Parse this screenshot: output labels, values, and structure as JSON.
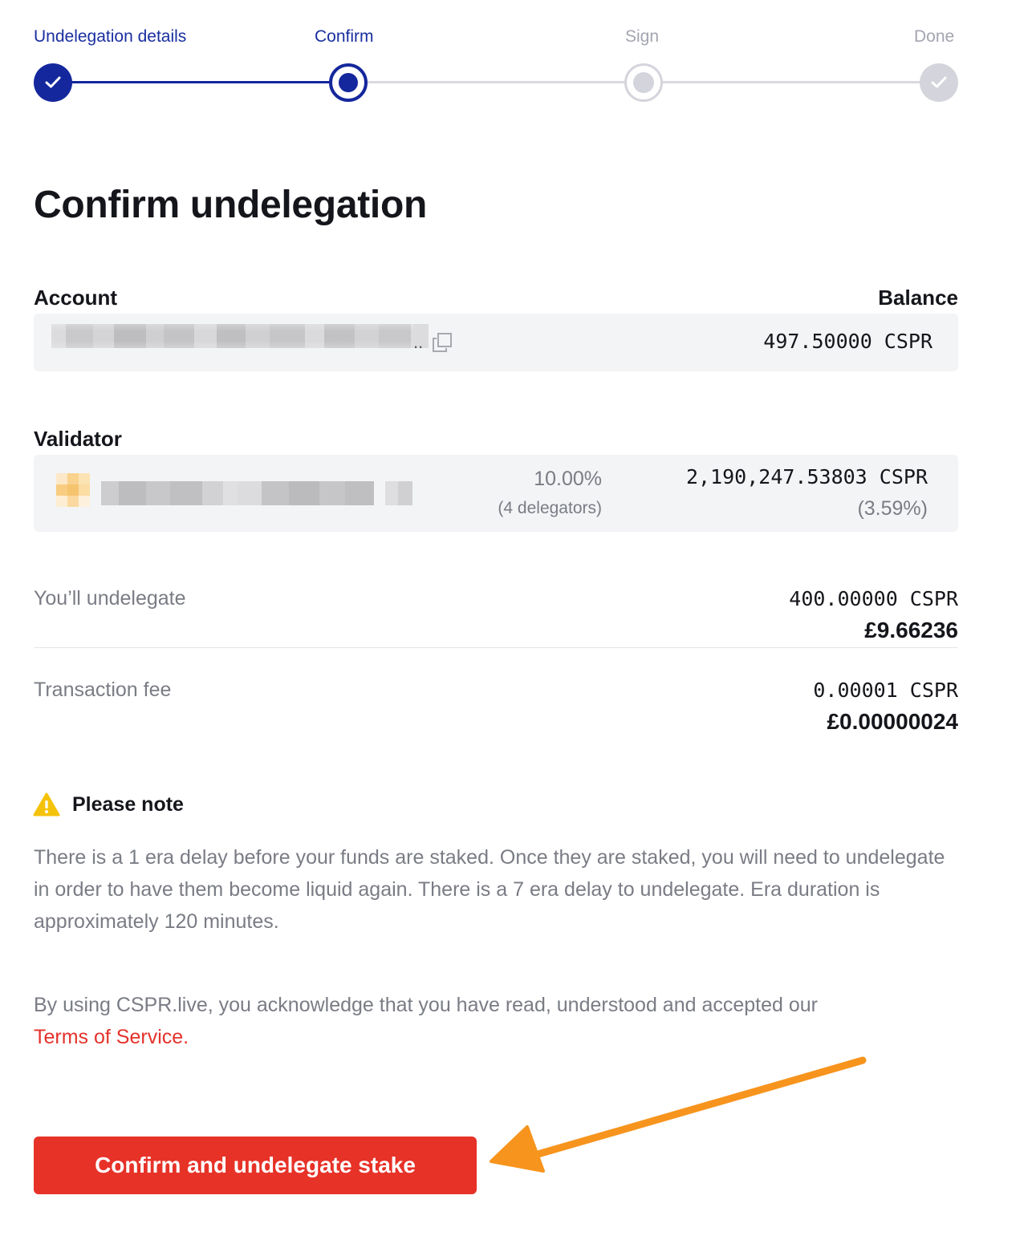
{
  "stepper": {
    "steps": [
      {
        "label": "Undelegation details",
        "state": "done"
      },
      {
        "label": "Confirm",
        "state": "current"
      },
      {
        "label": "Sign",
        "state": "pending"
      },
      {
        "label": "Done",
        "state": "pending"
      }
    ]
  },
  "page_title": "Confirm undelegation",
  "account": {
    "label": "Account",
    "balance_label": "Balance",
    "balance": "497.50000 CSPR",
    "address_suffix": ".."
  },
  "validator": {
    "label": "Validator",
    "commission": "10.00%",
    "delegators": "(4 delegators)",
    "stake": "2,190,247.53803 CSPR",
    "stake_share": "(3.59%)"
  },
  "undelegate": {
    "label": "You’ll undelegate",
    "amount": "400.00000 CSPR",
    "fiat": "£9.66236"
  },
  "fee": {
    "label": "Transaction fee",
    "amount": "0.00001 CSPR",
    "fiat": "£0.00000024"
  },
  "note": {
    "title": "Please note",
    "body": "There is a 1 era delay before your funds are staked. Once they are staked, you will need to undelegate in order to have them become liquid again. There is a 7 era delay to undelegate. Era duration is approximately 120 minutes."
  },
  "terms": {
    "text": "By using CSPR.live, you acknowledge that you have read, understood and accepted our",
    "link": "Terms of Service."
  },
  "cta_label": "Confirm and undelegate stake",
  "colors": {
    "primary": "#14279c",
    "cta": "#e73228",
    "link": "#e5322b",
    "annotation_arrow": "#f7941d",
    "warning": "#f5c20b"
  }
}
